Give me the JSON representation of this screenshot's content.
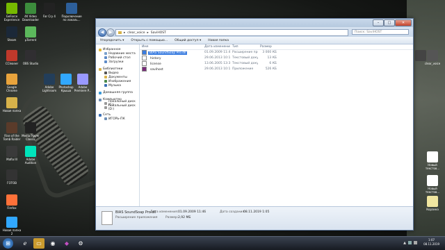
{
  "desktop": {
    "left_icons": [
      {
        "label": "GeForce Experience",
        "icon": "geforce-icon",
        "color": "#76b900"
      },
      {
        "label": "4K Video Downloader",
        "icon": "download-icon",
        "color": "#3c8c3c"
      },
      {
        "label": "Far Cry 4",
        "icon": "farcry-icon",
        "color": "#222222"
      },
      {
        "label": "Подключение по локаль...",
        "icon": "network-icon",
        "color": "#2d5f9a"
      },
      {
        "label": "Steam",
        "icon": "steam-icon",
        "color": "#1b2838"
      },
      {
        "label": "µTorrent",
        "icon": "utorrent-icon",
        "color": "#5cb85c"
      },
      {
        "label": "CCleaner",
        "icon": "ccleaner-icon",
        "color": "#c0392b"
      },
      {
        "label": "OBS Studio",
        "icon": "obs-icon",
        "color": "#302e31"
      },
      {
        "label": "Google Chrome",
        "icon": "chrome-icon",
        "color": "#e8a33c"
      },
      {
        "label": "Adobe Lightroom",
        "icon": "lightroom-icon",
        "color": "#233e5a"
      },
      {
        "label": "Photoshop Крыша",
        "icon": "photoshop-icon",
        "color": "#31a8ff"
      },
      {
        "label": "Adobe Premiere P...",
        "icon": "premiere-icon",
        "color": "#9999ff"
      },
      {
        "label": "Новая папка",
        "icon": "folder-icon",
        "color": "#d7b24a"
      },
      {
        "label": "Rise of the Tomb Raider",
        "icon": "game-icon",
        "color": "#5a3b2a"
      },
      {
        "label": "Media Player Classic",
        "icon": "media-player-icon",
        "color": "#222222"
      },
      {
        "label": "Mafia III",
        "icon": "mafia-icon",
        "color": "#3a3a3a"
      },
      {
        "label": "Adobe Audition",
        "icon": "audition-icon",
        "color": "#00e4bb"
      },
      {
        "label": "ГОТОВ",
        "icon": "video-icon",
        "color": "#333333"
      },
      {
        "label": "Firefox",
        "icon": "firefox-icon",
        "color": "#ff7139"
      },
      {
        "label": "Новая папка 2",
        "icon": "photoshop-icon",
        "color": "#31a8ff"
      }
    ],
    "right_icons": [
      {
        "label": "",
        "icon": "video-file-icon",
        "color": "#444444"
      },
      {
        "label": "clear_voice",
        "icon": "folder-icon",
        "color": "#555555"
      },
      {
        "label": "Новый текстов...",
        "icon": "text-file-icon",
        "color": "#ffffff"
      },
      {
        "label": "Новый текстов...",
        "icon": "text-file-icon",
        "color": "#ffffff"
      },
      {
        "label": "Корзина",
        "icon": "recycle-bin-icon",
        "color": "#f0e6a0"
      }
    ]
  },
  "explorer": {
    "breadcrumb": [
      "clear_voice",
      "SaviHOST"
    ],
    "search_placeholder": "Поиск: SaviHOST",
    "toolbar": [
      "Упорядочить ▾",
      "Открыть с помощью...",
      "Общий доступ ▾",
      "Новая папка"
    ],
    "nav": {
      "favorites_title": "Избранное",
      "favorites": [
        "Недавние места",
        "Рабочий стол",
        "Загрузки"
      ],
      "libraries_title": "Библиотеки",
      "libraries": [
        "Видео",
        "Документы",
        "Изображения",
        "Музыка"
      ],
      "homegroup": "Домашняя группа",
      "computer_title": "Компьютер",
      "drives": [
        "Локальный диск (C:)",
        "Локальный диск (D:)"
      ],
      "network_title": "Сеть",
      "network": [
        "ИГОРЬ-ПК"
      ]
    },
    "columns": [
      "Имя",
      "Дата изменения",
      "Тип",
      "Размер"
    ],
    "files": [
      {
        "name": "BIAS SoundSoap Pro.dll",
        "date": "01.09.2009 11:46",
        "type": "Расширение при...",
        "size": "3 000 КБ",
        "selected": true,
        "color": "#3b7de0"
      },
      {
        "name": "history",
        "date": "29.06.2013 10:18",
        "type": "Текстовый докум...",
        "size": "13 КБ",
        "selected": false,
        "color": "#ffffff"
      },
      {
        "name": "license",
        "date": "13.06.2005 13:35",
        "type": "Текстовый докум...",
        "size": "6 КБ",
        "selected": false,
        "color": "#ffffff"
      },
      {
        "name": "savihost",
        "date": "29.06.2013 10:19",
        "type": "Приложение",
        "size": "526 КБ",
        "selected": false,
        "color": "#7a2b7a"
      }
    ],
    "details": {
      "name": "BIAS SoundSoap Pro.dll",
      "modified_label": "Дата изменения:",
      "modified": "01.09.2009 11:46",
      "created_label": "Дата создания:",
      "created": "08.11.2019 1:05",
      "type": "Расширение приложения",
      "size_label": "Размер:",
      "size": "2,92 МБ"
    }
  },
  "taskbar": {
    "items": [
      "start-icon",
      "ie-icon",
      "folder-icon",
      "chrome-icon",
      "media-icon",
      "steam-icon"
    ],
    "clock_time": "1:07",
    "clock_date": "08.11.2019"
  }
}
